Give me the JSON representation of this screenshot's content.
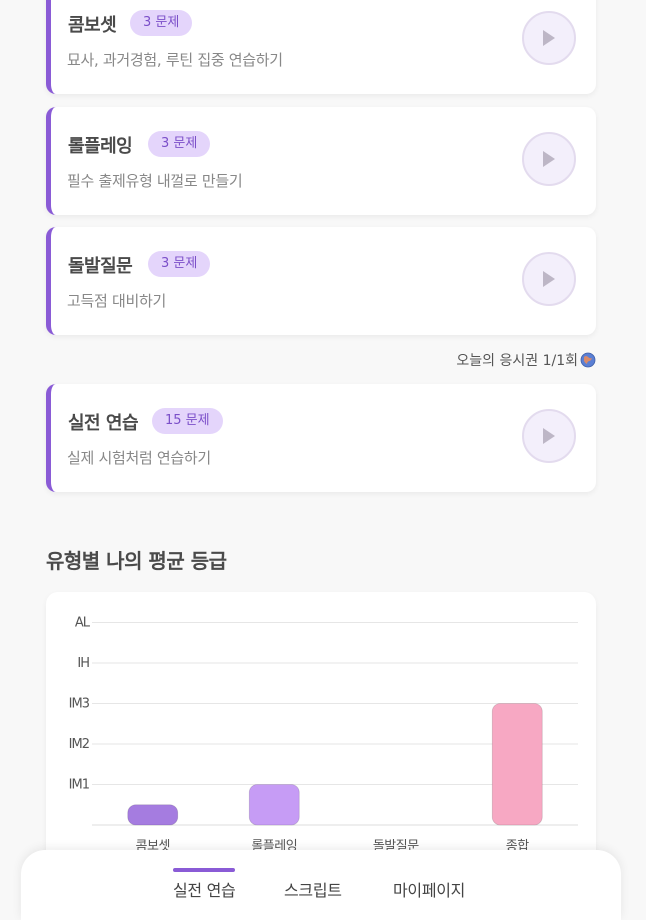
{
  "practice_cards": [
    {
      "title": "콤보셋",
      "badge": "3 문제",
      "subtitle": "묘사, 과거경험, 루틴 집중 연습하기"
    },
    {
      "title": "롤플레잉",
      "badge": "3 문제",
      "subtitle": "필수 출제유형 내껄로 만들기"
    },
    {
      "title": "돌발질문",
      "badge": "3 문제",
      "subtitle": "고득점 대비하기"
    }
  ],
  "ticket_text": "오늘의 응시권 1/1회",
  "real_test_card": {
    "title": "실전 연습",
    "badge": "15 문제",
    "subtitle": "실제 시험처럼 연습하기"
  },
  "section_title": "유형별 나의 평균 등급",
  "chart_data": {
    "type": "bar",
    "categories": [
      "콤보셋",
      "롤플레잉",
      "돌발질문",
      "종합"
    ],
    "y_levels": [
      "IM1",
      "IM2",
      "IM3",
      "IH",
      "AL"
    ],
    "values": [
      0.5,
      1,
      0,
      3
    ],
    "ylim": [
      0,
      5
    ],
    "grid": true,
    "colors": [
      "#a57ce0",
      "#c69cf5",
      "#c69cf5",
      "#f7a8c3"
    ]
  },
  "nav": {
    "items": [
      "실전 연습",
      "스크립트",
      "마이페이지"
    ],
    "active": "실전 연습",
    "accent": "#8a5bd6"
  }
}
